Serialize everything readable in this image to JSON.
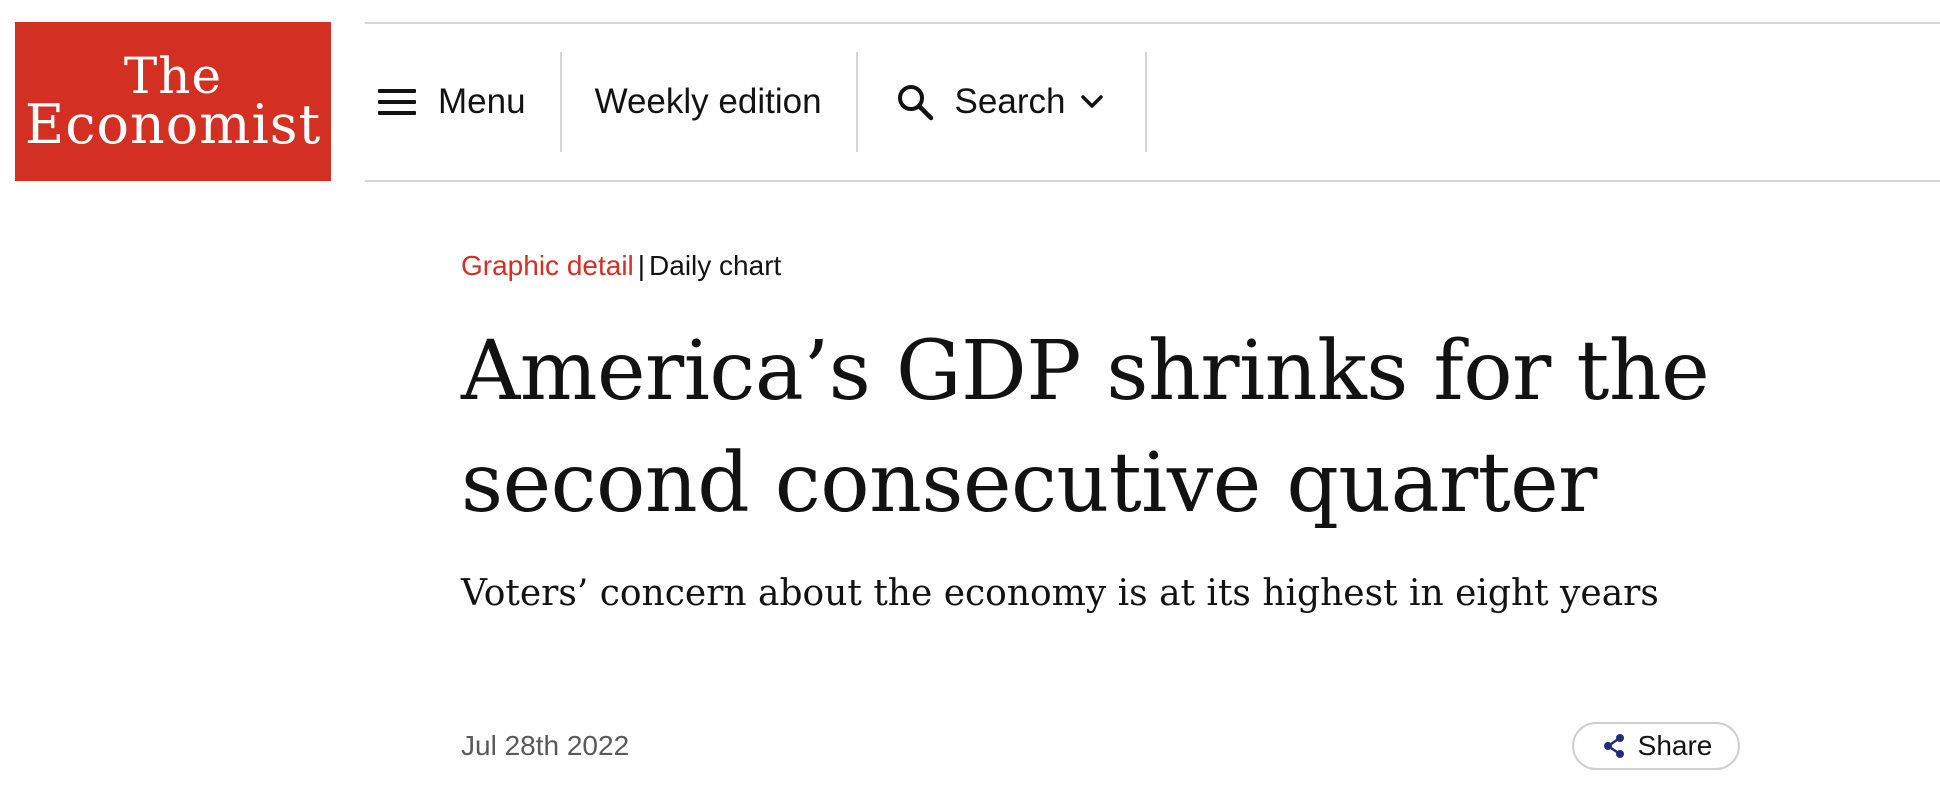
{
  "logo": {
    "line1": "The",
    "line2": "Economist",
    "color": "#d32f23"
  },
  "nav": {
    "menu_label": "Menu",
    "menu_icon": "hamburger-icon",
    "weekly_label": "Weekly edition",
    "search_label": "Search",
    "search_icon": "search-icon",
    "search_chevron_icon": "chevron-down-icon"
  },
  "article": {
    "section": "Graphic detail",
    "separator": "|",
    "subsection": "Daily chart",
    "headline": "America’s GDP shrinks for the second consecutive quarter",
    "subheadline": "Voters’ concern about the economy is at its highest in eight years",
    "date": "Jul 28th 2022",
    "share_label": "Share",
    "share_icon": "share-icon",
    "share_icon_color": "#1f2e7a"
  }
}
